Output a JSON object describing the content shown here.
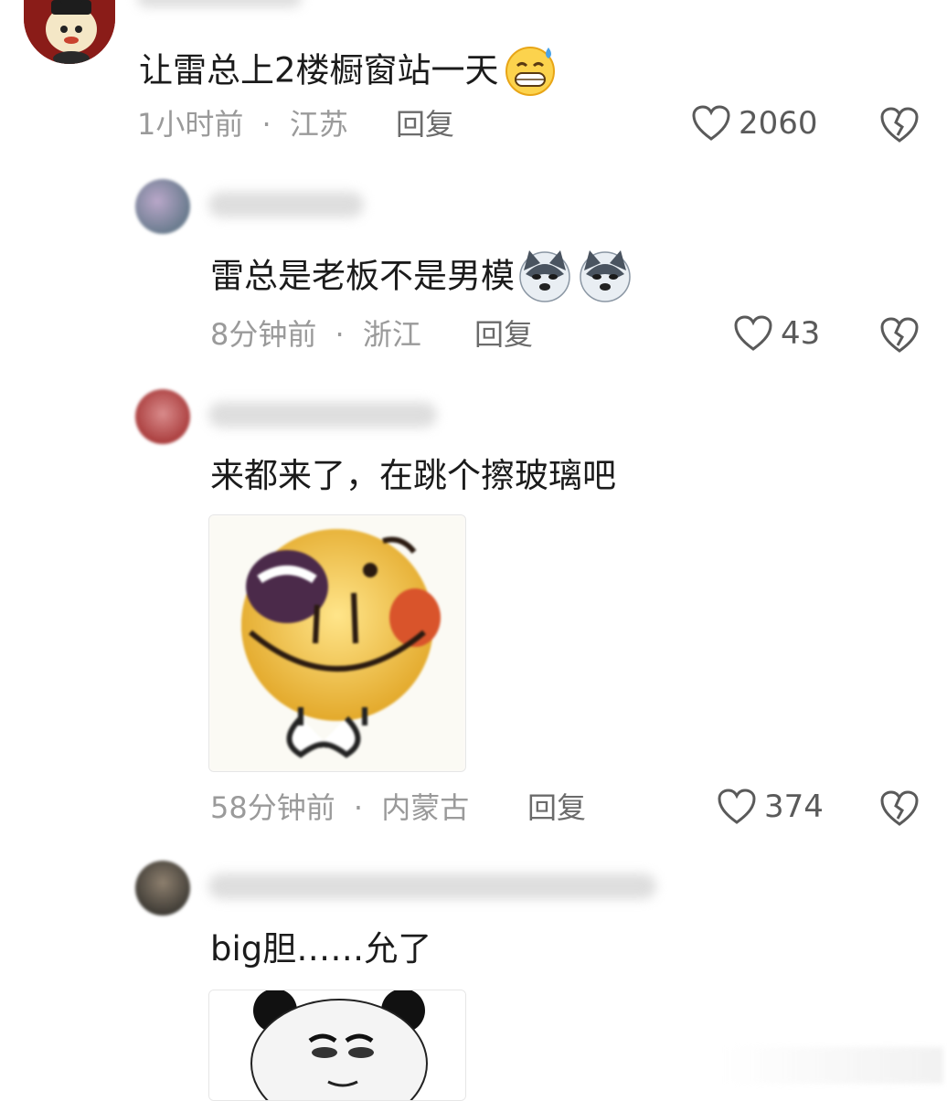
{
  "comments": [
    {
      "text": "让雷总上2楼橱窗站一天",
      "emoji": "grinning-sweat-emoji",
      "time": "1小时前",
      "separator": "·",
      "location": "江苏",
      "reply_label": "回复",
      "likes": "2060"
    },
    {
      "text": "雷总是老板不是男模",
      "emoji": "husky-dog-emoji",
      "time": "8分钟前",
      "separator": "·",
      "location": "浙江",
      "reply_label": "回复",
      "likes": "43"
    },
    {
      "text": "来都来了，在跳个擦玻璃吧",
      "sticker": "smiley-face-sticker",
      "time": "58分钟前",
      "separator": "·",
      "location": "内蒙古",
      "reply_label": "回复",
      "likes": "374"
    },
    {
      "text": "big胆……允了",
      "sticker": "panda-meme-sticker"
    }
  ],
  "colors": {
    "text": "#1b1b1b",
    "meta": "#9a9a9a",
    "icon": "#5a5a5a"
  }
}
